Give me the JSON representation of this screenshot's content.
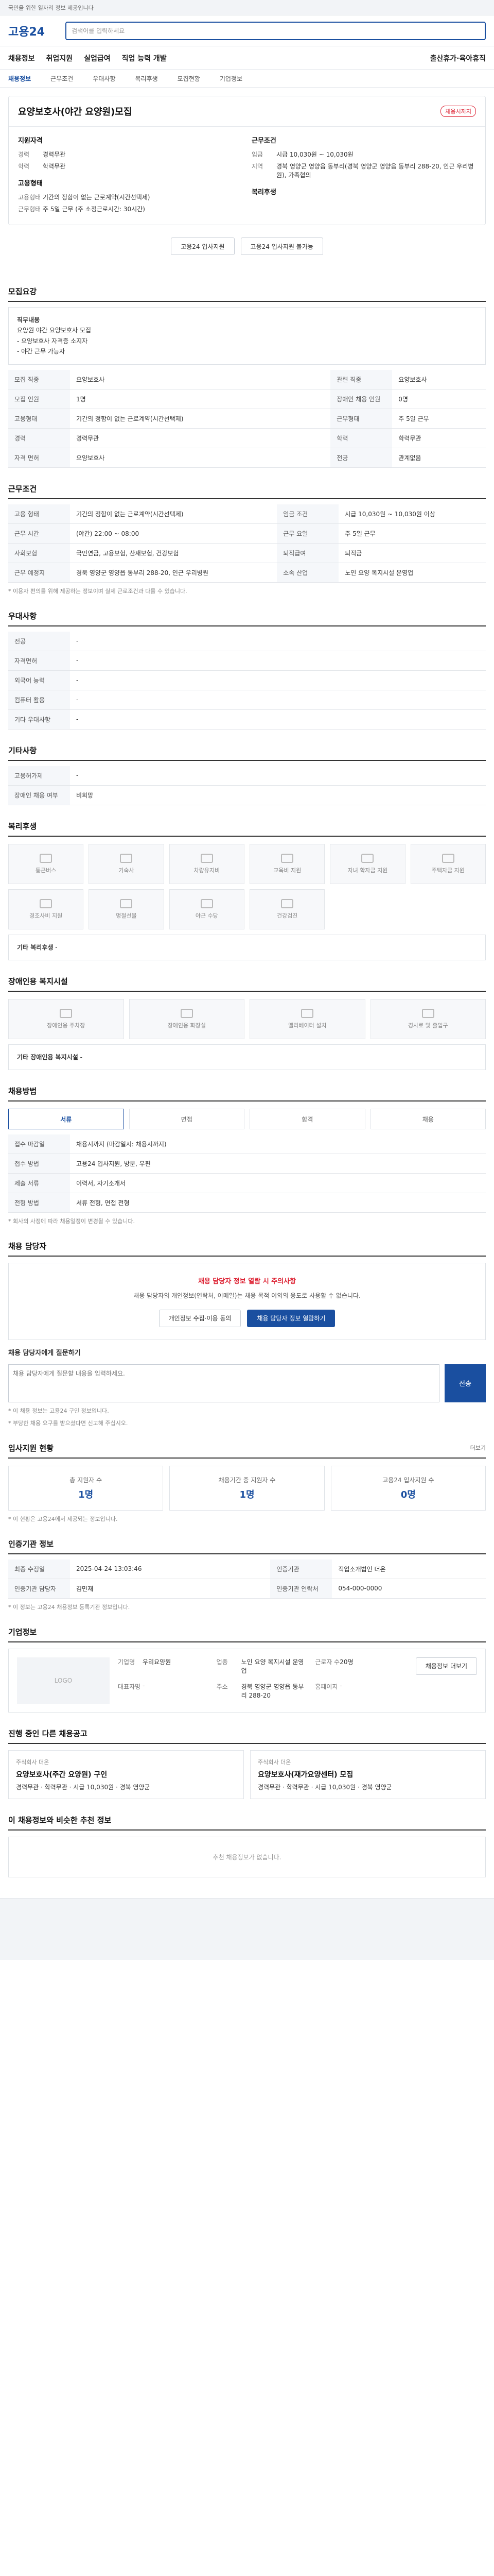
{
  "topbar": {
    "notice": "국민을 위한 일자리 정보 제공입니다"
  },
  "header": {
    "logo": "고용24",
    "search_placeholder": "검색어를 입력하세요"
  },
  "gnb": {
    "items": [
      "채용정보",
      "취업지원",
      "실업급여",
      "직업 능력 개발"
    ],
    "right": "출산휴가·육아휴직"
  },
  "lnb": {
    "items": [
      "채용정보",
      "근무조건",
      "우대사항",
      "복리후생",
      "모집현황",
      "기업정보"
    ],
    "active_index": 0
  },
  "job": {
    "title": "요양보호사(야간 요양원)모집",
    "badge": "채용시까지",
    "left_head": "지원자격",
    "left": [
      {
        "k": "경력",
        "v": "경력무관"
      },
      {
        "k": "학력",
        "v": "학력무관"
      }
    ],
    "left_head2": "고용형태",
    "left2": [
      {
        "k": "고용형태",
        "v": "기간의 정함이 없는 근로계약(시간선택제)"
      },
      {
        "k": "근무형태",
        "v": "주 5일 근무 (주 소정근로시간: 30시간)"
      }
    ],
    "right_head": "근무조건",
    "right": [
      {
        "k": "임금",
        "v": "시급 10,030원 ~ 10,030원"
      },
      {
        "k": "지역",
        "v": "경북 영양군 영양읍 동부리(경북 영양군 영양읍 동부리 288-20, 인근 우리병원), 가족협의"
      }
    ],
    "right_head2": "복리후생",
    "btn_apply": "고용24 입사지원",
    "btn_scrap": "고용24 입사지원 불가능"
  },
  "recruit": {
    "title": "모집요강",
    "duty_head": "직무내용",
    "duty_text": "요양원 야간 요양보호사 모집\n- 요양보호사 자격증 소지자\n- 야간 근무 가능자",
    "rows": [
      [
        "모집 직종",
        "요양보호사",
        "관련 직종",
        "요양보호사"
      ],
      [
        "모집 인원",
        "1명",
        "장애인 채용 인원",
        "0명"
      ],
      [
        "고용형태",
        "기간의 정함이 없는 근로계약(시간선택제)",
        "근무형태",
        "주 5일 근무"
      ],
      [
        "경력",
        "경력무관",
        "학력",
        "학력무관"
      ],
      [
        "자격 면허",
        "요양보호사",
        "전공",
        "관계없음"
      ]
    ]
  },
  "conditions": {
    "title": "근무조건",
    "rows": [
      [
        "고용 형태",
        "기간의 정함이 없는 근로계약(시간선택제)",
        "임금 조건",
        "시급 10,030원 ~ 10,030원 이상"
      ],
      [
        "근무 시간",
        "(야간) 22:00 ~ 08:00",
        "근무 요일",
        "주 5일 근무"
      ],
      [
        "사회보험",
        "국민연금, 고용보험, 산재보험, 건강보험",
        "퇴직급여",
        "퇴직금"
      ],
      [
        "근무 예정지",
        "경북 영양군 영양읍 동부리 288-20, 인근 우리병원",
        "소속 산업",
        "노인 요양 복지시설 운영업"
      ]
    ],
    "note": "* 이용자 편의를 위해 제공하는 정보이며 실제 근로조건과 다를 수 있습니다."
  },
  "preference": {
    "title": "우대사항",
    "rows": [
      [
        "전공",
        "-"
      ],
      [
        "자격면허",
        "-"
      ],
      [
        "외국어 능력",
        "-"
      ],
      [
        "컴퓨터 활용",
        "-"
      ],
      [
        "기타 우대사항",
        "-"
      ]
    ]
  },
  "etc": {
    "title": "기타사항",
    "rows": [
      [
        "고용허가제",
        "-"
      ],
      [
        "장애인 채용 여부",
        "비희망"
      ]
    ]
  },
  "welfare": {
    "title": "복리후생",
    "items": [
      "통근버스",
      "기숙사",
      "차량유지비",
      "교육비 지원",
      "자녀 학자금 지원",
      "주택자금 지원",
      "경조사비 지원",
      "명절선물",
      "야근 수당",
      "건강검진"
    ],
    "etc_label": "기타 복리후생",
    "etc_value": "-"
  },
  "disability": {
    "title": "장애인용 복지시설",
    "items": [
      "장애인용 주차장",
      "장애인용 화장실",
      "엘리베이터 설치",
      "경사로 및 출입구"
    ],
    "etc_label": "기타 장애인용 복지시설",
    "etc_value": "-"
  },
  "process": {
    "title": "채용방법",
    "steps": [
      "서류",
      "면접",
      "합격",
      "채용"
    ],
    "rows": [
      [
        "접수 마감일",
        "채용시까지 (마감일시: 채용시까지)"
      ],
      [
        "접수 방법",
        "고용24 입사지원, 방문, 우편"
      ],
      [
        "제출 서류",
        "이력서, 자기소개서"
      ],
      [
        "전형 방법",
        "서류 전형, 면접 전형"
      ]
    ],
    "note": "* 회사의 사정에 따라 채용일정이 변경될 수 있습니다."
  },
  "contact": {
    "title": "채용 담당자",
    "warn": "채용 담당자 정보 열람 시 주의사항",
    "text": "채용 담당자의 개인정보(연락처, 이메일)는 채용 목적 이외의 용도로 사용할 수 없습니다.",
    "btn1": "개인정보 수집·이용 동의",
    "btn2": "채용 담당자 정보 열람하기",
    "qa_title": "채용 담당자에게 질문하기",
    "qa_placeholder": "채용 담당자에게 질문할 내용을 입력하세요.",
    "qa_send": "전송",
    "notes": [
      "* 이 채용 정보는 고용24 구인 정보입니다.",
      "* 부당한 채용 요구를 받으셨다면 신고해 주십시오."
    ]
  },
  "apply_stat": {
    "title": "입사지원 현황",
    "more": "더보기",
    "items": [
      {
        "label": "총 지원자 수",
        "value": "1명"
      },
      {
        "label": "채용기간 중 지원자 수",
        "value": "1명"
      },
      {
        "label": "고용24 입사지원 수",
        "value": "0명"
      }
    ],
    "note": "* 이 현황은 고용24에서 제공되는 정보입니다."
  },
  "registry": {
    "title": "인증기관 정보",
    "rows": [
      [
        "최종 수정일",
        "2025-04-24 13:03:46",
        "인증기관",
        "직업소개법인 더온"
      ],
      [
        "인증기관 담당자",
        "김민재",
        "인증기관 연락처",
        "054-000-0000"
      ]
    ],
    "note": "* 이 정보는 고용24 채용정보 등록기관 정보입니다."
  },
  "company": {
    "title": "기업정보",
    "logo_text": "LOGO",
    "fields": [
      [
        "기업명",
        "우리요양원"
      ],
      [
        "업종",
        "노인 요양 복지시설 운영업"
      ],
      [
        "근로자 수",
        "20명"
      ],
      [
        "대표자명",
        "-"
      ],
      [
        "주소",
        "경북 영양군 영양읍 동부리 288-20"
      ],
      [
        "홈페이지",
        "-"
      ]
    ],
    "btn": "채용정보 더보기"
  },
  "related": {
    "title": "진행 중인 다른 채용공고",
    "jobs": [
      {
        "co": "주식회사 더온",
        "title": "요양보호사(주간 요양원) 구인",
        "meta": "경력무관 · 학력무관 · 시급 10,030원 · 경북 영양군"
      },
      {
        "co": "주식회사 더온",
        "title": "요양보호사(재가요양센터) 모집",
        "meta": "경력무관 · 학력무관 · 시급 10,030원 · 경북 영양군"
      }
    ]
  },
  "recommend": {
    "title": "이 채용정보와 비슷한 추천 정보",
    "empty": "추천 채용정보가 없습니다."
  }
}
